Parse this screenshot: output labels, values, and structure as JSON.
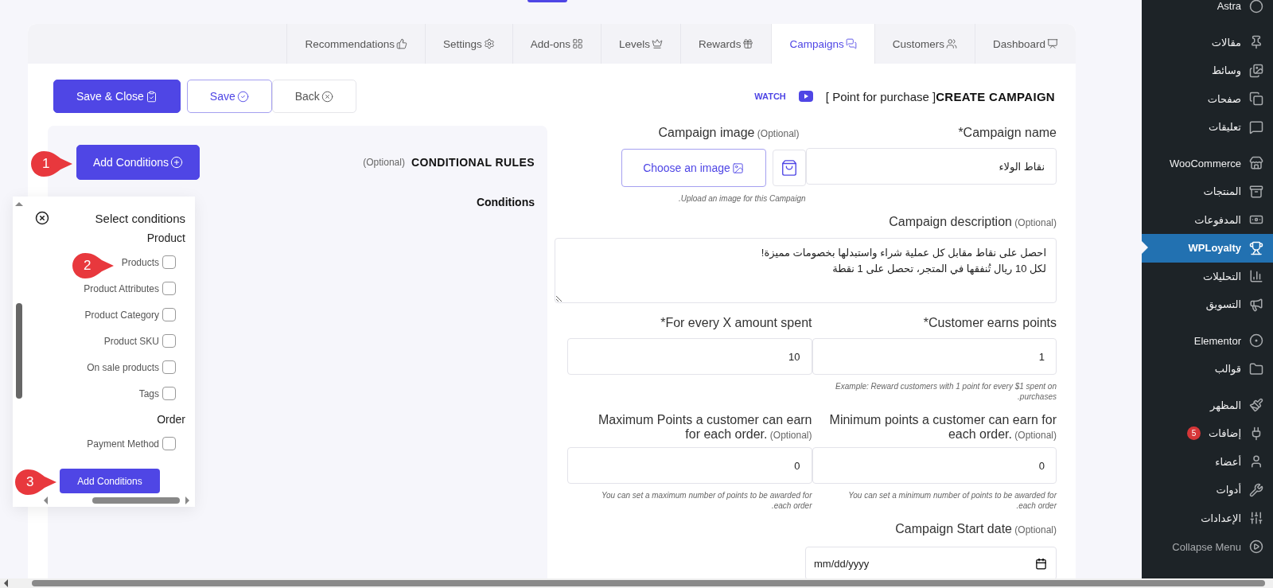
{
  "tabs": [
    {
      "label": "Recommendations",
      "selected": false
    },
    {
      "label": "Settings",
      "selected": false
    },
    {
      "label": "Add-ons",
      "selected": false
    },
    {
      "label": "Levels",
      "selected": false
    },
    {
      "label": "Rewards",
      "selected": false
    },
    {
      "label": "Campaigns",
      "selected": true
    },
    {
      "label": "Customers",
      "selected": false
    },
    {
      "label": "Dashboard",
      "selected": false
    }
  ],
  "toolbar": {
    "buttons": [
      {
        "label": "Save & Close",
        "kind": "primary"
      },
      {
        "label": "Save",
        "kind": "outline"
      },
      {
        "label": "Back",
        "kind": "plain"
      }
    ]
  },
  "heading": {
    "watch": "WATCH",
    "campaign_type": "[ Point for purchase ]",
    "title": "CREATE CAMPAIGN"
  },
  "conditional_rules": {
    "optional": "(Optional)",
    "title": "CONDITIONAL RULES",
    "add_button": "Add Conditions",
    "conditions_label": "Conditions"
  },
  "select_conditions": {
    "title": "Select conditions",
    "groups": [
      {
        "heading": "Product",
        "options": [
          {
            "label": "Products",
            "checked": false
          },
          {
            "label": "Product Attributes",
            "checked": false
          },
          {
            "label": "Product Category",
            "checked": false
          },
          {
            "label": "Product SKU",
            "checked": false
          },
          {
            "label": "On sale products",
            "checked": false
          },
          {
            "label": "Tags",
            "checked": false
          }
        ]
      },
      {
        "heading": "Order",
        "options": [
          {
            "label": "Payment Method",
            "checked": false
          }
        ]
      }
    ],
    "add_button": "Add Conditions"
  },
  "callouts": [
    "1",
    "2",
    "3"
  ],
  "form": {
    "campaign_name": {
      "label": "*Campaign name",
      "value": "نقاط الولاء"
    },
    "campaign_image": {
      "label": "Campaign image",
      "optional": "(Optional)",
      "button": "Choose an image",
      "hint": ".Upload an image for this Campaign"
    },
    "description": {
      "label": "Campaign description",
      "optional": "(Optional)",
      "value": "احصل على نقاط مقابل كل عملية شراء واستبدلها بخصومات مميزة!\nلكل 10 ريال تُنفقها في المتجر، تحصل على 1 نقطة"
    },
    "points_rows": [
      [
        {
          "label": "*For every X amount spent",
          "value": "10"
        },
        {
          "label": "*Customer earns points",
          "value": "1",
          "hint": "Example: Reward customers with 1 point for every $1 spent on .purchases"
        }
      ],
      [
        {
          "label": "Maximum Points a customer can earn for each order.",
          "optional": "(Optional)",
          "value": "0",
          "hint": "You can set a maximum number of points to be awarded for .each order"
        },
        {
          "label": "Minimum points a customer can earn for each order.",
          "optional": "(Optional)",
          "value": "0",
          "hint": "You can set a minimum number of points to be awarded for .each order"
        }
      ]
    ],
    "start_date": {
      "label": "Campaign Start date",
      "optional": "(Optional)",
      "placeholder": "mm/dd/yyyy"
    }
  },
  "sidebar": {
    "items": [
      {
        "label": "Astra",
        "selected": false,
        "separator_before": false
      },
      {
        "label": "مقالات",
        "selected": false,
        "separator_before": true
      },
      {
        "label": "وسائط",
        "selected": false,
        "separator_before": false
      },
      {
        "label": "صفحات",
        "selected": false,
        "separator_before": false
      },
      {
        "label": "تعليقات",
        "selected": false,
        "separator_before": false
      },
      {
        "label": "WooCommerce",
        "selected": false,
        "separator_before": true
      },
      {
        "label": "المنتجات",
        "selected": false,
        "separator_before": false
      },
      {
        "label": "المدفوعات",
        "selected": false,
        "separator_before": false
      },
      {
        "label": "WPLoyalty",
        "selected": true,
        "separator_before": false
      },
      {
        "label": "التحليلات",
        "selected": false,
        "separator_before": false
      },
      {
        "label": "التسويق",
        "selected": false,
        "separator_before": false
      },
      {
        "label": "Elementor",
        "selected": false,
        "separator_before": true
      },
      {
        "label": "قوالب",
        "selected": false,
        "separator_before": false
      },
      {
        "label": "المظهر",
        "selected": false,
        "separator_before": true
      },
      {
        "label": "إضافات",
        "selected": false,
        "separator_before": false,
        "badge": "5"
      },
      {
        "label": "أعضاء",
        "selected": false,
        "separator_before": false
      },
      {
        "label": "أدوات",
        "selected": false,
        "separator_before": false
      },
      {
        "label": "الإعدادات",
        "selected": false,
        "separator_before": false
      }
    ],
    "collapse": "Collapse Menu"
  }
}
